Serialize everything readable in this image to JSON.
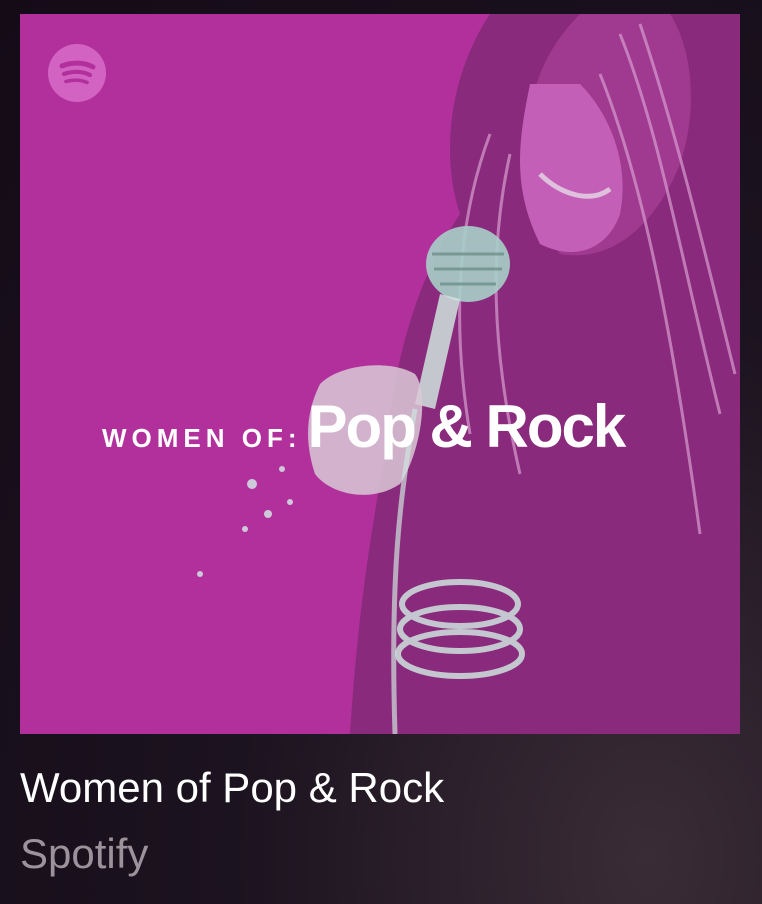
{
  "playlist": {
    "title": "Women of Pop & Rock",
    "owner": "Spotify"
  },
  "cover": {
    "prefix_text": "WOMEN OF:",
    "main_text": "Pop & Rock",
    "logo_icon": "spotify-icon",
    "background_color": "#b1309b",
    "accent_color": "#d668c6"
  }
}
